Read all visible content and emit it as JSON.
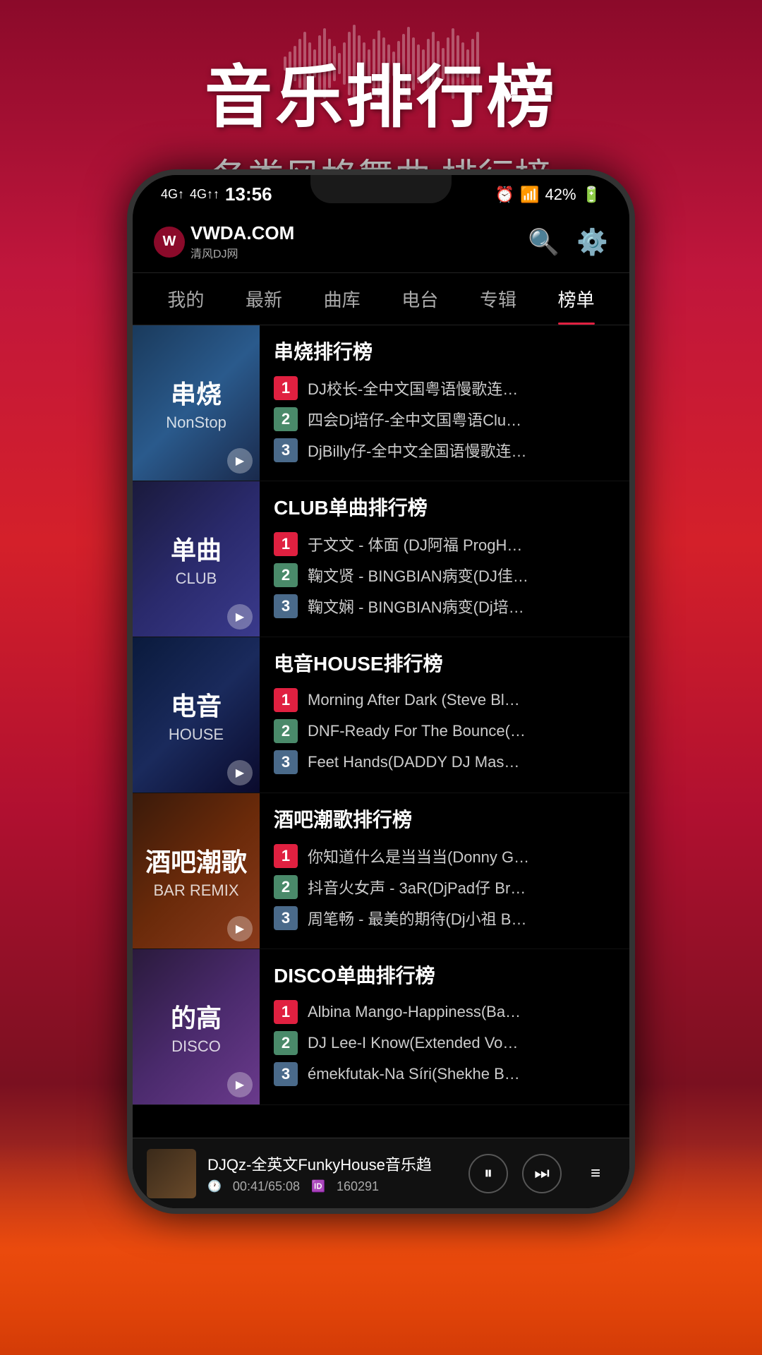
{
  "hero": {
    "title": "音乐排行榜",
    "subtitle": "各类风格舞曲 排行榜"
  },
  "status_bar": {
    "signal1": "4G",
    "signal2": "4G",
    "time": "13:56",
    "alarm": "⏰",
    "wifi": "WiFi",
    "battery": "42%"
  },
  "header": {
    "logo_text": "VWDA.COM",
    "logo_sub": "清风DJ网",
    "search_label": "搜索",
    "settings_label": "设置"
  },
  "nav": {
    "tabs": [
      "我的",
      "最新",
      "曲库",
      "电台",
      "专辑",
      "榜单"
    ],
    "active": "榜单"
  },
  "charts": [
    {
      "id": "chart-1",
      "thumb_title": "串烧",
      "thumb_subtitle": "NonStop",
      "thumb_class": "thumb-1",
      "title": "串烧排行榜",
      "tracks": [
        {
          "rank": 1,
          "name": "DJ校长-全中文国粤语慢歌连…"
        },
        {
          "rank": 2,
          "name": "四会Dj培仔-全中文国粤语Clu…"
        },
        {
          "rank": 3,
          "name": "DjBilly仔-全中文全国语慢歌连…"
        }
      ]
    },
    {
      "id": "chart-2",
      "thumb_title": "单曲",
      "thumb_subtitle": "CLUB",
      "thumb_class": "thumb-2",
      "title": "CLUB单曲排行榜",
      "tracks": [
        {
          "rank": 1,
          "name": "于文文 - 体面 (DJ阿福 ProgH…"
        },
        {
          "rank": 2,
          "name": "鞠文贤 - BINGBIAN病变(DJ佳…"
        },
        {
          "rank": 3,
          "name": "鞠文娴 - BINGBIAN病变(Dj培…"
        }
      ]
    },
    {
      "id": "chart-3",
      "thumb_title": "电音",
      "thumb_subtitle": "HOUSE",
      "thumb_class": "thumb-3",
      "title": "电音HOUSE排行榜",
      "tracks": [
        {
          "rank": 1,
          "name": "Morning After Dark (Steve Bl…"
        },
        {
          "rank": 2,
          "name": "DNF-Ready For The Bounce(…"
        },
        {
          "rank": 3,
          "name": "Feet Hands(DADDY DJ Mas…"
        }
      ]
    },
    {
      "id": "chart-4",
      "thumb_title": "酒吧潮歌",
      "thumb_subtitle": "BAR REMIX",
      "thumb_class": "thumb-4",
      "title": "酒吧潮歌排行榜",
      "tracks": [
        {
          "rank": 1,
          "name": "你知道什么是当当当(Donny G…"
        },
        {
          "rank": 2,
          "name": "抖音火女声 - 3aR(DjPad仔 Br…"
        },
        {
          "rank": 3,
          "name": "周笔畅 - 最美的期待(Dj小祖 B…"
        }
      ]
    },
    {
      "id": "chart-5",
      "thumb_title": "的高",
      "thumb_subtitle": "DISCO",
      "thumb_class": "thumb-5",
      "title": "DISCO单曲排行榜",
      "tracks": [
        {
          "rank": 1,
          "name": "Albina Mango-Happiness(Ba…"
        },
        {
          "rank": 2,
          "name": "DJ Lee-I Know(Extended Vo…"
        },
        {
          "rank": 3,
          "name": "émekfutak-Na Síri(Shekhe B…"
        }
      ]
    }
  ],
  "player": {
    "title": "DJQz-全英文FunkyHouse音乐趋",
    "time": "00:41/65:08",
    "id_label": "160291",
    "pause_icon": "⏸",
    "next_icon": "⏭",
    "list_icon": "≡"
  }
}
